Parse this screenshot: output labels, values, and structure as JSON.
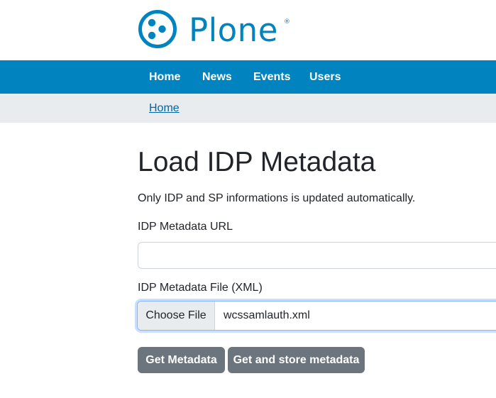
{
  "brand": {
    "name": "Plone",
    "registered_mark": "®",
    "color": "#0083be"
  },
  "nav": {
    "items": [
      {
        "label": "Home"
      },
      {
        "label": "News"
      },
      {
        "label": "Events"
      },
      {
        "label": "Users"
      }
    ]
  },
  "breadcrumb": {
    "home_label": "Home"
  },
  "page": {
    "title": "Load IDP Metadata",
    "description": "Only IDP and SP informations is updated automatically."
  },
  "form": {
    "url_label": "IDP Metadata URL",
    "url_value": "",
    "file_label": "IDP Metadata File (XML)",
    "file_button_label": "Choose File",
    "file_name": "wcssamlauth.xml",
    "get_metadata_label": "Get Metadata",
    "get_and_store_label": "Get and store metadata"
  },
  "colors": {
    "navbar_bg": "#0083be",
    "breadcrumb_bg": "#e9ecef",
    "button_bg": "#6c757d",
    "link": "#0066a8"
  }
}
